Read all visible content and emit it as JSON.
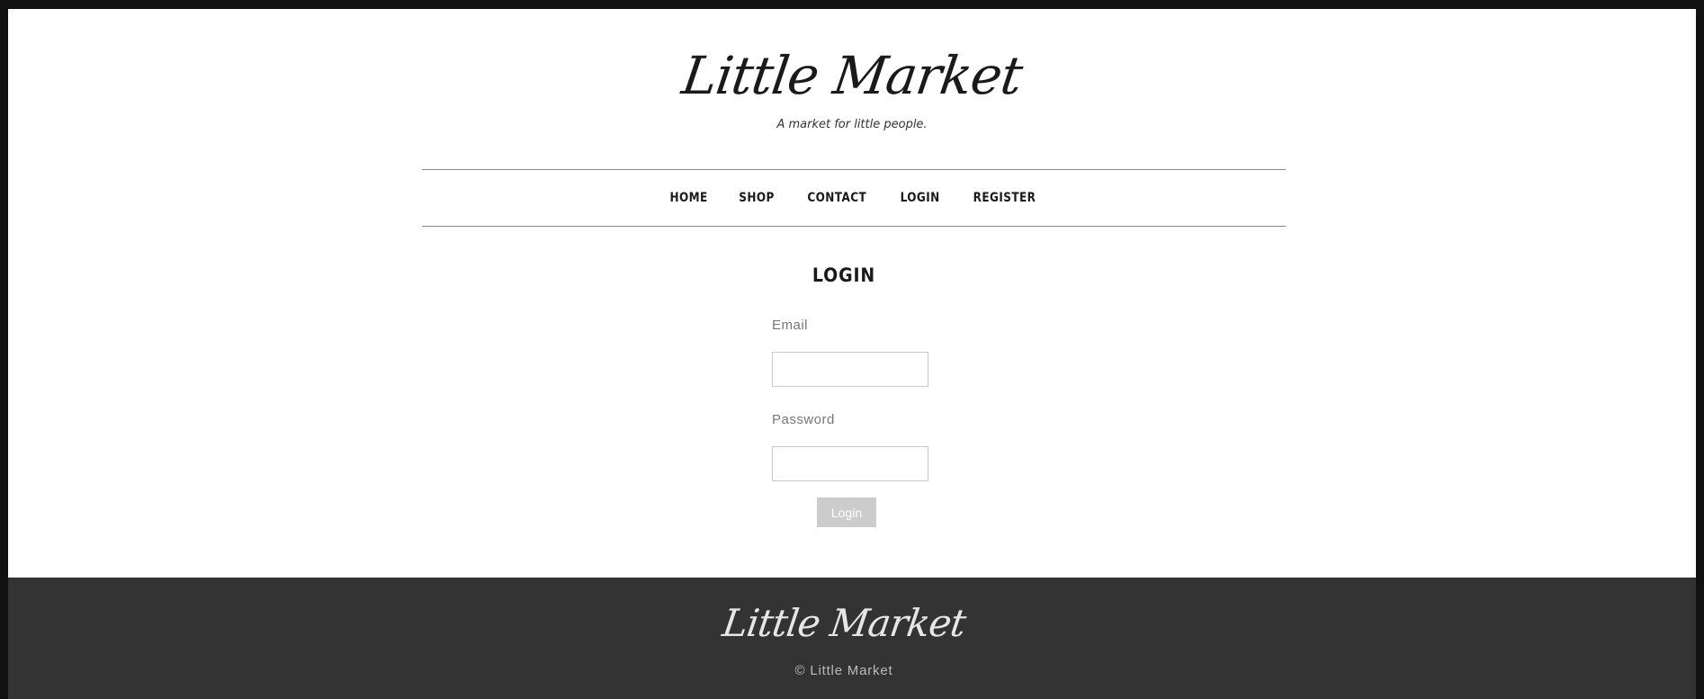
{
  "header": {
    "logo": "Little Market",
    "tagline": "A market for little people."
  },
  "nav": {
    "items": [
      {
        "label": "HOME"
      },
      {
        "label": "SHOP"
      },
      {
        "label": "CONTACT"
      },
      {
        "label": "LOGIN"
      },
      {
        "label": "REGISTER"
      }
    ]
  },
  "main": {
    "title": "LOGIN",
    "email_label": "Email",
    "email_value": "",
    "password_label": "Password",
    "password_value": "",
    "submit_label": "Login"
  },
  "footer": {
    "logo": "Little Market",
    "copyright": "© Little Market"
  },
  "colors": {
    "page_border": "#111111",
    "footer_bg": "#333333",
    "button_bg": "#cccccc",
    "nav_rule": "#888888"
  }
}
